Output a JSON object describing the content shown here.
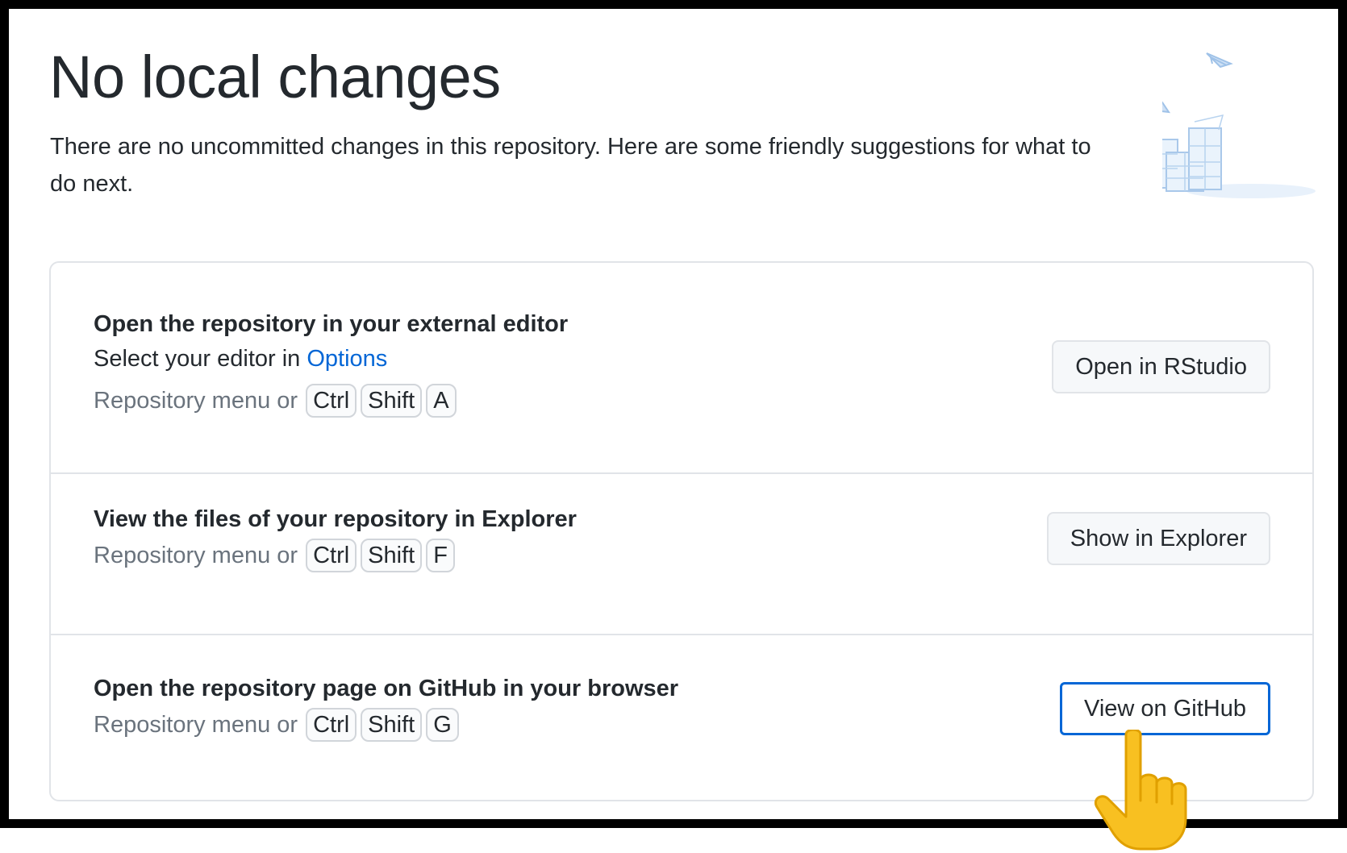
{
  "header": {
    "title": "No local changes",
    "subtitle": "There are no uncommitted changes in this repository. Here are some friendly suggestions for what to do next."
  },
  "suggestions": [
    {
      "title": "Open the repository in your external editor",
      "description_prefix": "Select your editor in ",
      "description_link": "Options",
      "shortcut_prefix": "Repository menu or",
      "keys": [
        "Ctrl",
        "Shift",
        "A"
      ],
      "button_label": "Open in RStudio"
    },
    {
      "title": "View the files of your repository in Explorer",
      "shortcut_prefix": "Repository menu or",
      "keys": [
        "Ctrl",
        "Shift",
        "F"
      ],
      "button_label": "Show in Explorer"
    },
    {
      "title": "Open the repository page on GitHub in your browser",
      "shortcut_prefix": "Repository menu or",
      "keys": [
        "Ctrl",
        "Shift",
        "G"
      ],
      "button_label": "View on GitHub"
    }
  ],
  "colors": {
    "link": "#0366d6",
    "focus_border": "#0366d6",
    "text": "#24292e",
    "muted": "#6a737d",
    "pointer": "#f5b800"
  },
  "icons": {
    "illustration": "empty-boxes-illustration",
    "cursor": "pointing-hand-icon"
  }
}
